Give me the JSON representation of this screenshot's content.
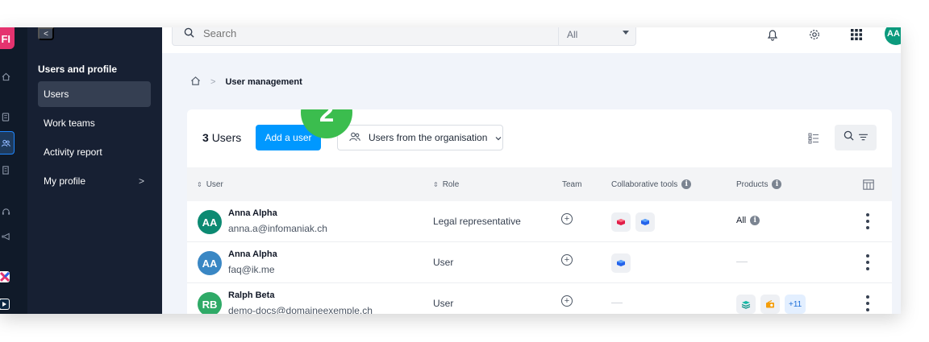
{
  "rail": {
    "logo_text": "FI",
    "icons": [
      "home-icon",
      "device-icon",
      "users-icon",
      "building-icon",
      "support-icon",
      "megaphone-icon",
      "app-x-icon",
      "app-arrow-icon"
    ],
    "accent": "#e5336f"
  },
  "sidebar": {
    "collapse_label": "<",
    "title": "Users and profile",
    "items": [
      {
        "label": "Users",
        "active": true
      },
      {
        "label": "Work teams",
        "active": false
      },
      {
        "label": "Activity report",
        "active": false
      },
      {
        "label": "My profile",
        "active": false,
        "has_submenu": true
      }
    ],
    "submenu_chevron": ">"
  },
  "topbar": {
    "search_placeholder": "Search",
    "scope_value": "All",
    "avatar_initials": "AA"
  },
  "breadcrumb": {
    "current": "User management",
    "separator": ">"
  },
  "card": {
    "user_count": "3",
    "user_count_label": "Users",
    "add_user_label": "Add a user",
    "org_filter_label": "Users from the organisation",
    "step_badge": "2",
    "accent": "#0098ff",
    "step_color": "#3bbd4e"
  },
  "table": {
    "headers": {
      "user": "User",
      "role": "Role",
      "team": "Team",
      "tools": "Collaborative tools",
      "products": "Products"
    },
    "rows": [
      {
        "initials": "AA",
        "avatar_color": "#0c8a72",
        "name": "Anna Alpha",
        "email": "anna.a@infomaniak.ch",
        "role": "Legal representative",
        "tools": [
          "kdrive-icon",
          "kchat-icon"
        ],
        "products_label": "All",
        "products": [],
        "products_more": ""
      },
      {
        "initials": "AA",
        "avatar_color": "#3a87c4",
        "name": "Anna Alpha",
        "email": "faq@ik.me",
        "role": "User",
        "tools": [
          "kchat-icon"
        ],
        "products_label": "",
        "products": [],
        "products_more": ""
      },
      {
        "initials": "RB",
        "avatar_color": "#2faa67",
        "name": "Ralph Beta",
        "email": "demo-docs@domaineexemple.ch",
        "role": "User",
        "tools": [],
        "products_label": "",
        "products": [
          "hosting-icon",
          "radio-icon"
        ],
        "products_more": "+11"
      }
    ]
  }
}
